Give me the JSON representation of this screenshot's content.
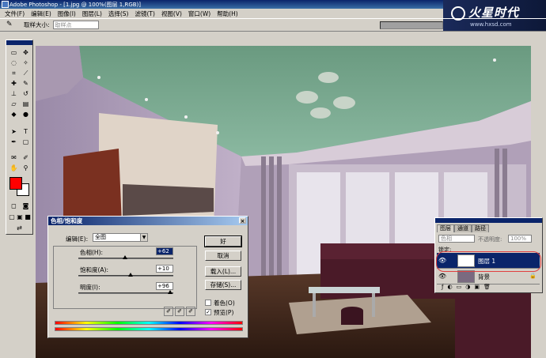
{
  "app": {
    "title": "Adobe Photoshop - [1.jpg @ 100%(图层 1,RGB)]"
  },
  "brand": {
    "logo_text": "火星时代",
    "url": "www.hxsd.com"
  },
  "menu": [
    "文件(F)",
    "编辑(E)",
    "图像(I)",
    "图层(L)",
    "选择(S)",
    "滤镜(T)",
    "视图(V)",
    "窗口(W)",
    "帮助(H)"
  ],
  "options_bar": {
    "sample_size_label": "取样大小:",
    "sample_size_value": "取样点"
  },
  "dialog": {
    "title": "色相/饱和度",
    "close": "×",
    "edit_label": "编辑(E):",
    "edit_value": "全图",
    "hue_label": "色相(H):",
    "hue_value": "+62",
    "saturation_label": "饱和度(A):",
    "saturation_value": "+10",
    "lightness_label": "明度(I):",
    "lightness_value": "+96",
    "buttons": {
      "ok": "好",
      "cancel": "取消",
      "load": "载入(L)...",
      "save": "存储(S)..."
    },
    "colorize_label": "着色(O)",
    "colorize_checked": false,
    "preview_label": "预览(P)",
    "preview_checked": true
  },
  "layers_panel": {
    "tabs": [
      "图层",
      "通道",
      "路径"
    ],
    "blend_mode": "色相",
    "opacity_label": "不透明度:",
    "opacity_value": "100%",
    "lock_label": "锁定:",
    "layers": [
      {
        "name": "图层 1",
        "selected": true
      },
      {
        "name": "背景",
        "selected": false
      }
    ]
  },
  "colors": {
    "foreground": "#ff0000",
    "background": "#ffffff",
    "selection": "#0a246a",
    "annotation": "#e04040"
  }
}
